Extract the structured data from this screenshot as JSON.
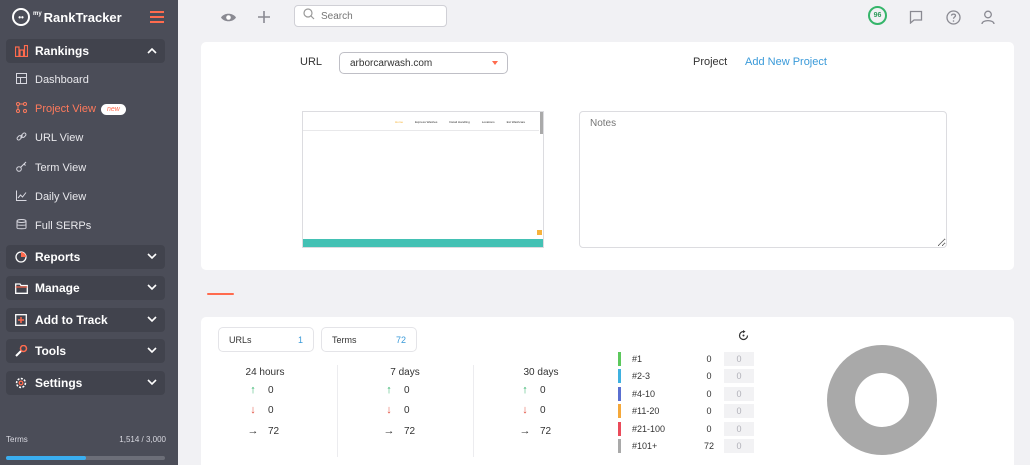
{
  "app": {
    "brand_prefix": "my",
    "brand_name": "RankTracker"
  },
  "sidebar": {
    "groups": [
      {
        "label": "Rankings",
        "expanded": true
      },
      {
        "label": "Reports",
        "expanded": false
      },
      {
        "label": "Manage",
        "expanded": false
      },
      {
        "label": "Add to Track",
        "expanded": false
      },
      {
        "label": "Tools",
        "expanded": false
      },
      {
        "label": "Settings",
        "expanded": false
      }
    ],
    "rankings_items": [
      {
        "label": "Dashboard",
        "icon": "dashboard-icon"
      },
      {
        "label": "Project View",
        "icon": "project-view-icon",
        "active": true,
        "badge": "new"
      },
      {
        "label": "URL View",
        "icon": "link-icon"
      },
      {
        "label": "Term View",
        "icon": "key-icon"
      },
      {
        "label": "Daily View",
        "icon": "line-chart-icon"
      },
      {
        "label": "Full SERPs",
        "icon": "database-icon"
      }
    ],
    "footer": {
      "label": "Terms",
      "usage": "1,514 / 3,000",
      "fraction": 0.505
    }
  },
  "topbar": {
    "search_placeholder": "Search",
    "score": "96"
  },
  "project": {
    "url_label": "URL",
    "url_value": "arborcarwash.com",
    "project_label": "Project",
    "add_project_link": "Add New Project",
    "notes_placeholder": "Notes",
    "preview_nav": [
      "Home",
      "Express Washes",
      "Detail Handling",
      "Locations",
      "Ext Washcare"
    ]
  },
  "summary": {
    "urls_label": "URLs",
    "urls_count": "1",
    "terms_label": "Terms",
    "terms_count": "72",
    "periods": [
      {
        "label": "24 hours",
        "up": "0",
        "down": "0",
        "same": "72"
      },
      {
        "label": "7 days",
        "up": "0",
        "down": "0",
        "same": "72"
      },
      {
        "label": "30 days",
        "up": "0",
        "down": "0",
        "same": "72"
      }
    ],
    "rank_buckets": [
      {
        "label": "#1",
        "count": "0",
        "change": "0",
        "color": "#5cc85c"
      },
      {
        "label": "#2-3",
        "count": "0",
        "change": "0",
        "color": "#3fb1e0"
      },
      {
        "label": "#4-10",
        "count": "0",
        "change": "0",
        "color": "#5a6fd0"
      },
      {
        "label": "#11-20",
        "count": "0",
        "change": "0",
        "color": "#f5a83a"
      },
      {
        "label": "#21-100",
        "count": "0",
        "change": "0",
        "color": "#ea4b5a"
      },
      {
        "label": "#101+",
        "count": "72",
        "change": "0",
        "color": "#a9a9a9"
      }
    ]
  },
  "colors": {
    "accent": "#ff6b4e",
    "link": "#3a9ad9",
    "sidebar_bg": "#4b4d58"
  }
}
